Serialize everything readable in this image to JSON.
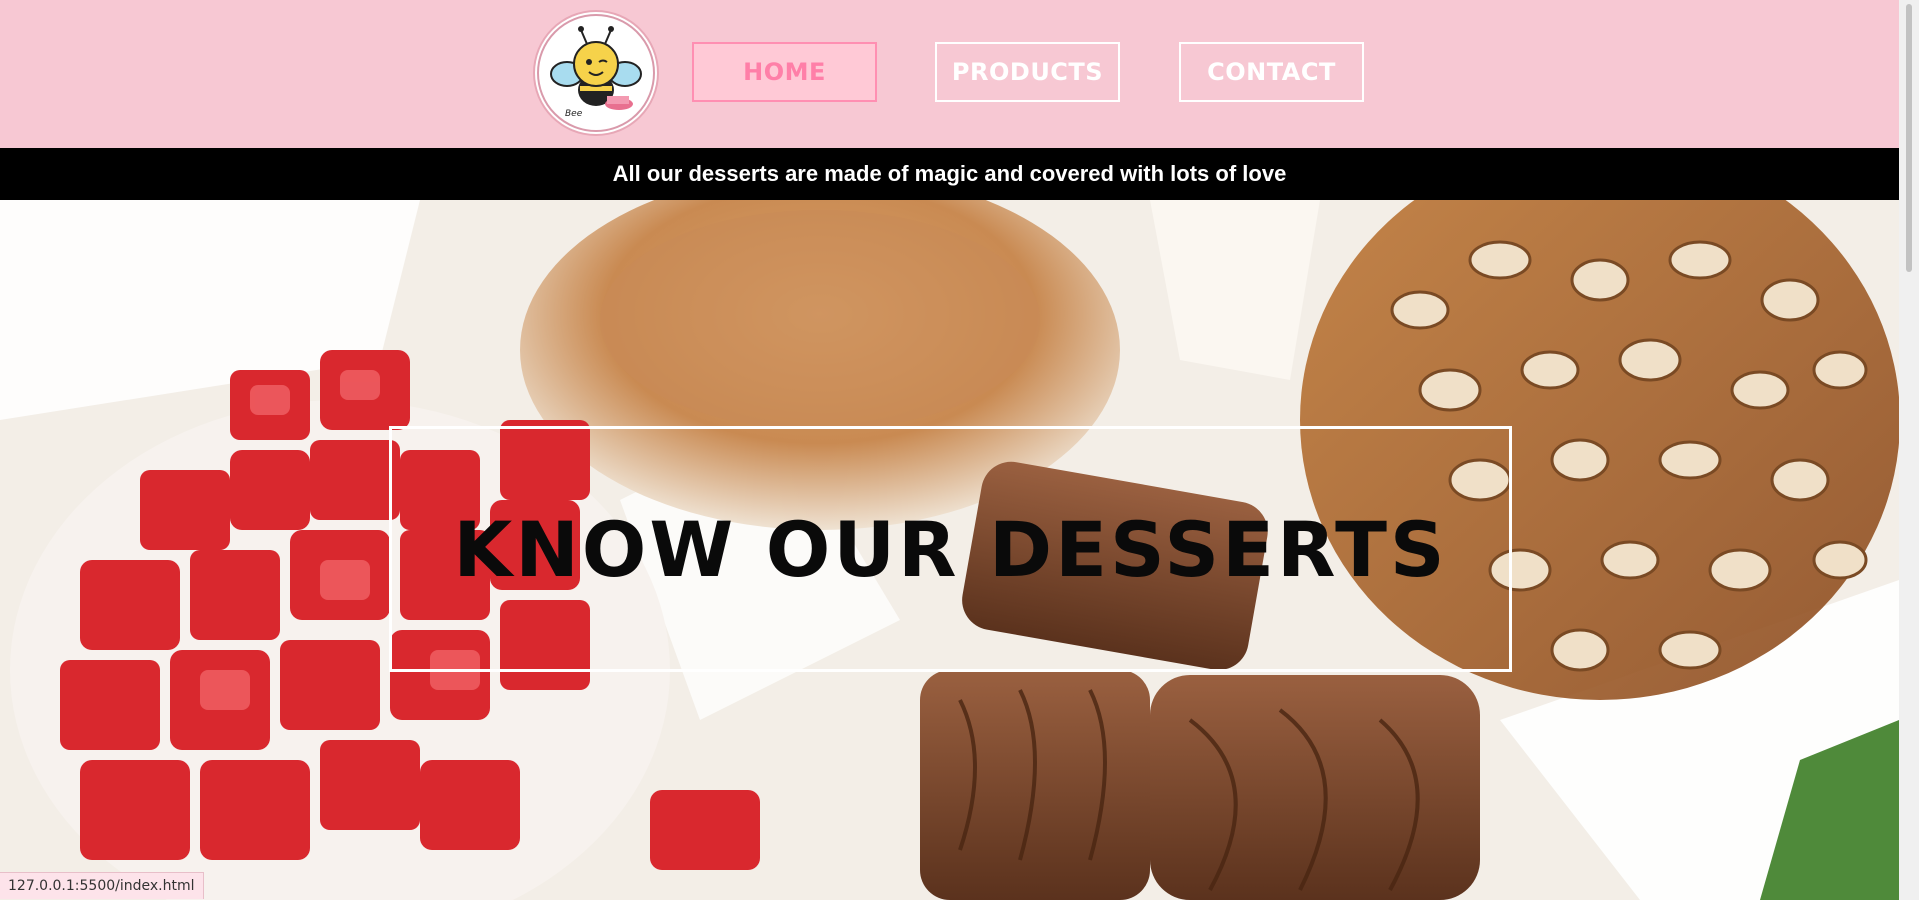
{
  "header": {
    "logo_icon": "bee-logo-icon",
    "nav": [
      {
        "label": "HOME",
        "active": true
      },
      {
        "label": "PRODUCTS",
        "active": false
      },
      {
        "label": "CONTACT",
        "active": false
      }
    ]
  },
  "announcement": "All our desserts are made of magic and covered with lots of love",
  "hero": {
    "title": "KNOW OUR DESSERTS"
  },
  "status_bar": {
    "url": "127.0.0.1:5500/index.html"
  },
  "colors": {
    "header_bg": "#f7c8d3",
    "active_nav_text": "#ff7fa8",
    "announce_bg": "#000000"
  }
}
